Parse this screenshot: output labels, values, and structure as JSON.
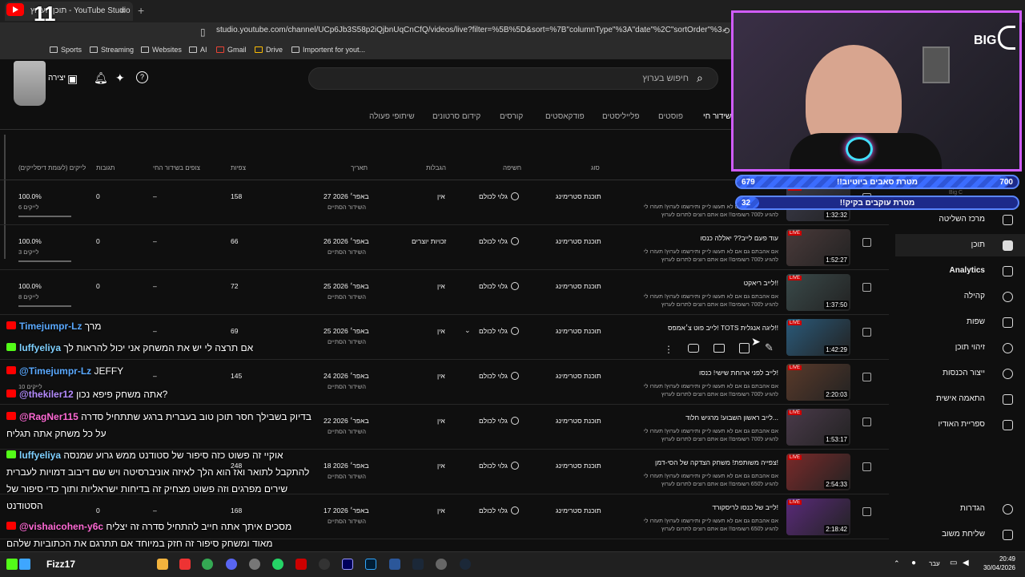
{
  "browser": {
    "tab_title": "תוכן הערוץ - YouTube Studio",
    "url": "studio.youtube.com/channel/UCp6Jb3S58p2iQjbnUqCnCfQ/videos/live?filter=%5B%5D&sort=%7B\"columnType\"%3A\"date\"%2C\"sortOrder\"%3...",
    "bookmarks": [
      "Sports",
      "Streaming",
      "Websites",
      "AI",
      "Gmail",
      "Drive",
      "Importent for yout..."
    ]
  },
  "overlay_counters": {
    "top": "11",
    "bottom": "6"
  },
  "header": {
    "search_placeholder": "חיפוש בערוץ",
    "create_label": "יצירה"
  },
  "tabs": [
    "שידור חי",
    "פוסטים",
    "פלייליסטים",
    "פודקאסטים",
    "קורסים",
    "קידום סרטונים",
    "שיתופי פעולה"
  ],
  "columns": {
    "video": "סוג",
    "visibility": "חשיפה",
    "restrictions": "הגבלות",
    "date": "תאריך",
    "views": "צפיות",
    "live_viewers": "צופים בשידור החי",
    "comments": "תגובות",
    "likes": "לייקים (לעומת דיסלייקים)"
  },
  "rows": [
    {
      "title": "",
      "desc1": "אם אהבתם גם אם לא תעשו לייק ותירשמו לערוץ! תעזרו לי",
      "desc2": "להגיע ל700 רשומים!! אם אתם רוצים לתרום לערוץ",
      "dur": "1:32:32",
      "type": "תוכנת סטרימינג",
      "visibility": "גלוי לכולם",
      "restrictions": "אין",
      "date": "27 באפר׳ 2026",
      "date_sub": "השידור הסתיים",
      "views": "158",
      "live": "–",
      "comments": "0",
      "likes": "100.0%",
      "likes_sub": "6 לייקים"
    },
    {
      "title": "עוד פעם לייב?? יאללה כנסו",
      "desc1": "אם אהבתם גם אם לא תעשו לייק ותירשמו לערוץ! תעזרו לי",
      "desc2": "להגיע ל700 רשומים!! אם אתם רוצים לתרום לערוץ",
      "dur": "1:52:27",
      "type": "תוכנת סטרימינג",
      "visibility": "גלוי לכולם",
      "restrictions": "זכויות יוצרים",
      "date": "26 באפר׳ 2026",
      "date_sub": "השידור הסתיים",
      "views": "66",
      "live": "–",
      "comments": "0",
      "likes": "100.0%",
      "likes_sub": "3 לייקים"
    },
    {
      "title": "לייב ריאקט!!",
      "desc1": "אם אהבתם גם אם לא תעשו לייק ותירשמו לערוץ! תעזרו לי",
      "desc2": "להגיע ל700 רשומים!! אם אתם רוצים לתרום לערוץ",
      "dur": "1:37:50",
      "type": "תוכנת סטרימינג",
      "visibility": "גלוי לכולם",
      "restrictions": "אין",
      "date": "25 באפר׳ 2026",
      "date_sub": "השידור הסתיים",
      "views": "72",
      "live": "–",
      "comments": "0",
      "likes": "100.0%",
      "likes_sub": "8 לייקים"
    },
    {
      "title": "לייב פוט צ׳אמפס! TOTS ליגה אנגלית!!",
      "desc1": "",
      "desc2": "",
      "dur": "1:42:29",
      "type": "תוכנת סטרימינג",
      "visibility": "גלוי לכולם",
      "restrictions": "אין",
      "date": "25 באפר׳ 2026",
      "date_sub": "השידור הסתיים",
      "views": "69",
      "live": "–",
      "comments": "",
      "likes": "",
      "likes_sub": ""
    },
    {
      "title": "לייב לפני ארוחת שישי! כנסו!",
      "desc1": "אם אהבתם גם אם לא תעשו לייק ותירשמו לערוץ! תעזרו לי",
      "desc2": "להגיע ל700 רשומים!! אם אתם רוצים לתרום לערוץ",
      "dur": "2:20:03",
      "type": "תוכנת סטרימינג",
      "visibility": "גלוי לכולם",
      "restrictions": "אין",
      "date": "24 באפר׳ 2026",
      "date_sub": "השידור הסתיים",
      "views": "145",
      "live": "–",
      "comments": "",
      "likes": "",
      "likes_sub": "10 לייקים"
    },
    {
      "title": "לייב ראשון השבוע! מרגיש חלוד...",
      "desc1": "אם אהבתם גם אם לא תעשו לייק ותירשמו לערוץ! תעזרו לי",
      "desc2": "להגיע ל700 רשומים!! אם אתם רוצים לתרום לערוץ",
      "dur": "1:53:17",
      "type": "תוכנת סטרימינג",
      "visibility": "גלוי לכולם",
      "restrictions": "אין",
      "date": "22 באפר׳ 2026",
      "date_sub": "השידור הסתיים",
      "views": "",
      "live": "",
      "comments": "",
      "likes": "",
      "likes_sub": ""
    },
    {
      "title": "צפייה משותפת! משחק הצדקה של הסי-דמן!",
      "desc1": "אם אהבתם גם אם לא תעשו לייק ותירשמו לערוץ! תעזרו לי",
      "desc2": "להגיע ל650 רשומים!! אם אתם רוצים לתרום לערוץ",
      "dur": "2:54:33",
      "type": "תוכנת סטרימינג",
      "visibility": "גלוי לכולם",
      "restrictions": "אין",
      "date": "18 באפר׳ 2026",
      "date_sub": "השידור הסתיים",
      "views": "248",
      "live": "",
      "comments": "",
      "likes": "",
      "likes_sub": ""
    },
    {
      "title": "לייב של כנסו לריסקורד!",
      "desc1": "אם אהבתם גם אם לא תעשו לייק ותירשמו לערוץ! תעזרו לי",
      "desc2": "להגיע ל650 רשומים!! אם אתם רוצים לתרום לערוץ",
      "dur": "2:18:42",
      "type": "תוכנת סטרימינג",
      "visibility": "גלוי לכולם",
      "restrictions": "אין",
      "date": "17 באפר׳ 2026",
      "date_sub": "השידור הסתיים",
      "views": "168",
      "live": "–",
      "comments": "0",
      "likes": "",
      "likes_sub": ""
    }
  ],
  "sidebar": [
    "מרכז השליטה",
    "תוכן",
    "Analytics",
    "קהילה",
    "שפות",
    "זיהוי תוכן",
    "ייצור הכנסות",
    "התאמה אישית",
    "ספריית האודיו",
    "הגדרות",
    "שליחת משוב"
  ],
  "cam": {
    "brand": "BIG",
    "goals": [
      {
        "label": "!!מטרת סאבים ביוטיוב",
        "current": "679",
        "target": "700",
        "progress": 0.97
      },
      {
        "label": "!!מטרת עוקבים בקיק",
        "current": "32",
        "target": "",
        "progress": 0.02
      }
    ]
  },
  "chat": [
    {
      "user": "Timejumpr-Lz",
      "msg": "מרך",
      "platform": "youtube",
      "color": "#5aa9ff"
    },
    {
      "user": "luffyeliya",
      "msg": "אם תרצה לי יש את המשחק אני יכול להראות לך",
      "platform": "kick",
      "color": "#7fd0ff"
    },
    {
      "user": "@Timejumpr-Lz",
      "msg": "JEFFY",
      "platform": "youtube",
      "color": "#5aa9ff"
    },
    {
      "user": "@thekiler12",
      "msg": "אתה משחק פיפא נכון?",
      "platform": "youtube",
      "color": "#b58cff"
    },
    {
      "user": "@RagNer115",
      "msg": "בדיוק בשבילך חסר תוכן טוב בעברית ברגע שתתחיל סדרה",
      "platform": "youtube",
      "color": "#ff6ad5"
    },
    {
      "user": "",
      "msg": "על כל משחק אתה תגליח",
      "platform": "",
      "color": "#ffffff"
    },
    {
      "user": "luffyeliya",
      "msg": "אוקיי זה פשוט כזה סיפור של סטודנט ממש גרוע שמנסה",
      "platform": "kick",
      "color": "#7fd0ff"
    },
    {
      "user": "",
      "msg": "להתקבל לתואר ואז הוא הלך לאיזה אוניברסיטה ויש שם דיבוב דמויות לעברית",
      "platform": "",
      "color": "#ffffff"
    },
    {
      "user": "",
      "msg": "שירים מפרגים וזה פשוט מצחיק זה בדיחות ישראליות ותוך כדי סיפור של",
      "platform": "",
      "color": "#ffffff"
    },
    {
      "user": "",
      "msg": "הסטודנט",
      "platform": "",
      "color": "#ffffff"
    },
    {
      "user": "@vishaicohen-y6c",
      "msg": "מסכים איתך אתה חייב להתחיל סדרה זה יצליח",
      "platform": "youtube",
      "color": "#ff6ad5"
    },
    {
      "user": "",
      "msg": "מאוד ומשחק סיפור זה חזק במיוחד אם תתרגם את הכתוביות שלהם",
      "platform": "",
      "color": "#ffffff"
    }
  ],
  "taskbar": {
    "user": "Fizz17",
    "lang": "עבר",
    "time": "20:49",
    "date": "30/04/2026"
  }
}
